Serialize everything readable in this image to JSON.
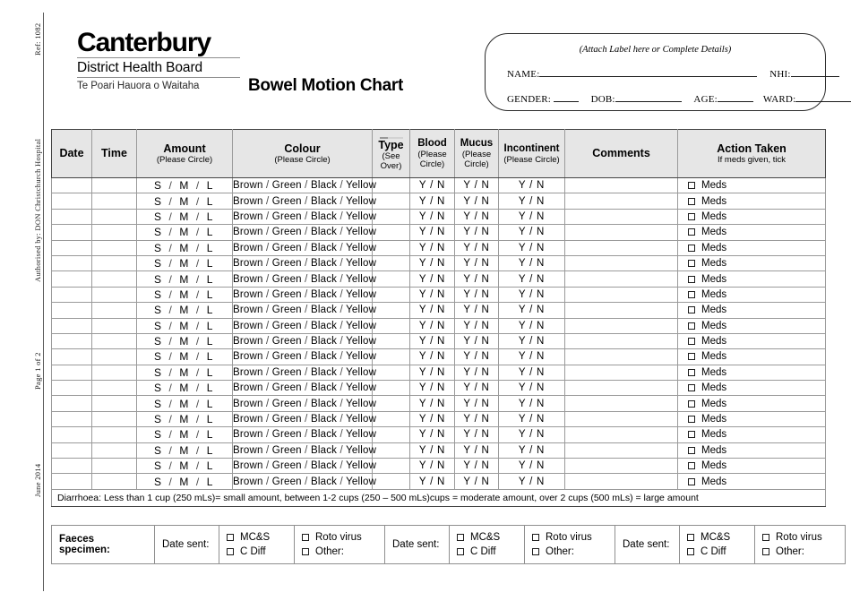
{
  "margin": {
    "ref": "Ref: 1082",
    "authorised": "Authorised by: DON Christchurch Hospital",
    "page": "Page 1 of 2",
    "date": "June 2014"
  },
  "logo": {
    "main": "Canterbury",
    "sub": "District Health Board",
    "maori": "Te Poari Hauora o Waitaha"
  },
  "title": "Bowel Motion Chart",
  "patient": {
    "note": "(Attach Label here or Complete Details)",
    "name_label": "NAME:",
    "nhi_label": "NHI:",
    "gender_label": "GENDER:",
    "dob_label": "DOB:",
    "age_label": "AGE:",
    "ward_label": "WARD:",
    "name_value": "",
    "nhi_value": "",
    "gender_value": "",
    "dob_value": "",
    "age_value": "",
    "ward_value": ""
  },
  "table": {
    "headers": {
      "date": "Date",
      "time": "Time",
      "amount": "Amount",
      "amount_sub": "(Please Circle)",
      "colour": "Colour",
      "colour_sub": "(Please Circle)",
      "type": "Type",
      "type_sub1": "(See",
      "type_sub2": "Over)",
      "blood": "Blood",
      "blood_sub1": "(Please",
      "blood_sub2": "Circle)",
      "mucus": "Mucus",
      "mucus_sub1": "(Please",
      "mucus_sub2": "Circle)",
      "incontinent": "Incontinent",
      "incontinent_sub": "(Please Circle)",
      "comments": "Comments",
      "action": "Action Taken",
      "action_sub": "If meds given, tick"
    },
    "row_template": {
      "date": "",
      "time": "",
      "amount_options": [
        "S",
        "M",
        "L"
      ],
      "amount_separator": "/",
      "colour_options": [
        "Brown",
        "Green",
        "Black",
        "Yellow"
      ],
      "colour_separator": "/",
      "type": "",
      "blood": "Y / N",
      "mucus": "Y / N",
      "incontinent": "Y / N",
      "comments": "",
      "action_checkbox_label": "Meds"
    },
    "row_count": 20,
    "note": "Diarrhoea: Less than 1 cup (250 mLs)= small amount, between 1-2 cups (250 – 500 mLs)cups = moderate amount, over 2 cups (500 mLs) = large amount"
  },
  "specimen": {
    "title": "Faeces specimen:",
    "date_sent_label": "Date sent:",
    "groups": [
      {
        "a": "MC&S",
        "b": "C Diff",
        "c": "Roto virus",
        "d": "Other:"
      },
      {
        "a": "MC&S",
        "b": "C Diff",
        "c": "Roto virus",
        "d": "Other:"
      },
      {
        "a": "MC&S",
        "b": "C Diff",
        "c": "Roto virus",
        "d": "Other:"
      }
    ]
  },
  "colors": {
    "header_fill": "#e6e6e6",
    "grid_line": "#9a9a9a",
    "border_strong": "#444444",
    "text": "#000000"
  }
}
